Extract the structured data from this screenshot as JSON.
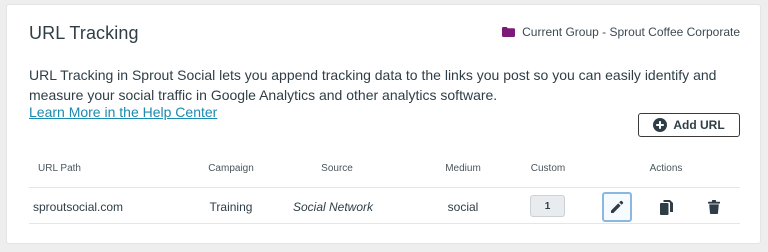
{
  "header": {
    "title": "URL Tracking",
    "group_label": "Current Group - Sprout Coffee Corporate",
    "group_icon": "folder-icon",
    "group_icon_color": "#7b1a78"
  },
  "description": "URL Tracking in Sprout Social lets you append tracking data to the links you post so you can easily identify and measure your social traffic in Google Analytics and other analytics software.",
  "help_link": "Learn More in the Help Center",
  "add_button": {
    "label": "Add URL",
    "icon": "plus-circle-icon"
  },
  "table": {
    "columns": [
      "URL Path",
      "Campaign",
      "Source",
      "Medium",
      "Custom",
      "Actions"
    ],
    "rows": [
      {
        "url_path": "sproutsocial.com",
        "campaign": "Training",
        "source": "Social Network",
        "medium": "social",
        "custom": "1",
        "actions": [
          "pencil-icon",
          "copy-icon",
          "trash-icon"
        ]
      }
    ]
  },
  "colors": {
    "link": "#1a8ab0",
    "text": "#2f3e46",
    "edit_focus_border": "#8ab8e0"
  }
}
